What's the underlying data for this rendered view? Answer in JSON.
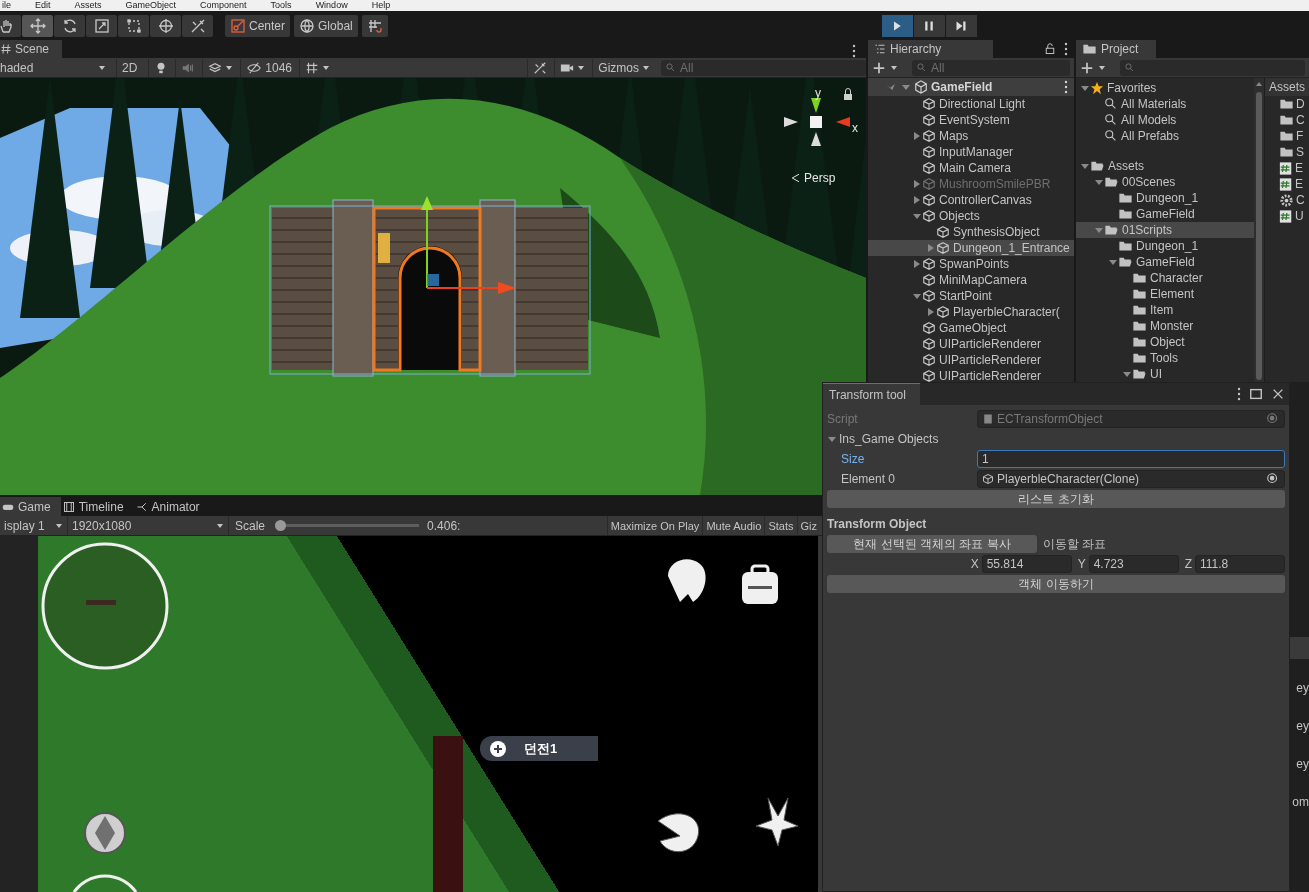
{
  "menu": [
    "ile",
    "Edit",
    "Assets",
    "GameObject",
    "Component",
    "Tools",
    "Window",
    "Help"
  ],
  "tools": [
    {
      "kind": "hand",
      "selected": false
    },
    {
      "kind": "move",
      "selected": true
    },
    {
      "kind": "rotate",
      "selected": false
    },
    {
      "kind": "scale",
      "selected": false
    },
    {
      "kind": "rect",
      "selected": false
    },
    {
      "kind": "transform",
      "selected": false
    },
    {
      "kind": "custom",
      "selected": false
    }
  ],
  "pivot_buttons": [
    {
      "kind": "pivot",
      "label": "Center"
    },
    {
      "kind": "space",
      "label": "Global"
    },
    {
      "kind": "snap"
    }
  ],
  "playback": [
    {
      "kind": "play",
      "on": true
    },
    {
      "kind": "pause",
      "on": false
    },
    {
      "kind": "step",
      "on": false
    }
  ],
  "scene": {
    "tab": "Scene",
    "shading": "haded",
    "mode_2d": "2D",
    "hidden_count": "1046",
    "gizmos": "Gizmos",
    "search_placeholder": "All",
    "axis_y": "y",
    "axis_x": "x",
    "projection": "Persp"
  },
  "hierarchy": {
    "tab": "Hierarchy",
    "search_placeholder": "All",
    "root": "GameField",
    "items": [
      {
        "label": "Directional Light",
        "disabled": false,
        "selected": false
      },
      {
        "label": "EventSystem",
        "disabled": false,
        "selected": false
      },
      {
        "label": "Maps",
        "expanded": false,
        "disabled": false,
        "selected": false
      },
      {
        "label": "InputManager",
        "disabled": false,
        "selected": false
      },
      {
        "label": "Main Camera",
        "disabled": false,
        "selected": false
      },
      {
        "label": "MushroomSmilePBR",
        "expanded": false,
        "disabled": true,
        "selected": false
      },
      {
        "label": "ControllerCanvas",
        "expanded": false,
        "disabled": false,
        "selected": false
      },
      {
        "label": "Objects",
        "expanded": true,
        "disabled": false,
        "selected": false,
        "children": [
          {
            "label": "SynthesisObject",
            "disabled": false,
            "selected": false
          },
          {
            "label": "Dungeon_1_Entrance",
            "expanded": false,
            "disabled": false,
            "selected": true
          }
        ]
      },
      {
        "label": "SpwanPoints",
        "expanded": false,
        "disabled": false,
        "selected": false
      },
      {
        "label": "MiniMapCamera",
        "disabled": false,
        "selected": false
      },
      {
        "label": "StartPoint",
        "expanded": true,
        "disabled": false,
        "selected": false,
        "children": [
          {
            "label": "PlayerbleCharacter(",
            "expanded": false,
            "disabled": false,
            "selected": false
          }
        ]
      },
      {
        "label": "GameObject",
        "disabled": false,
        "selected": false
      },
      {
        "label": "UIParticleRenderer",
        "disabled": false,
        "selected": false
      },
      {
        "label": "UIParticleRenderer",
        "disabled": false,
        "selected": false
      },
      {
        "label": "UIParticleRenderer",
        "disabled": false,
        "selected": false
      }
    ]
  },
  "project": {
    "tab": "Project",
    "tree": [
      {
        "label": "Favorites",
        "kind": "star",
        "expanded": true,
        "selected": false,
        "children": [
          {
            "label": "All Materials",
            "kind": "search",
            "selected": false
          },
          {
            "label": "All Models",
            "kind": "search",
            "selected": false
          },
          {
            "label": "All Prefabs",
            "kind": "search",
            "selected": false
          }
        ]
      },
      {
        "label": "Assets",
        "kind": "folder",
        "expanded": true,
        "selected": false,
        "children": [
          {
            "label": "00Scenes",
            "kind": "folder",
            "expanded": true,
            "selected": false,
            "children": [
              {
                "label": "Dungeon_1",
                "kind": "folder",
                "selected": false
              },
              {
                "label": "GameField",
                "kind": "folder",
                "selected": false
              }
            ]
          },
          {
            "label": "01Scripts",
            "kind": "folder",
            "expanded": true,
            "selected": true,
            "children": [
              {
                "label": "Dungeon_1",
                "kind": "folder",
                "selected": false
              },
              {
                "label": "GameField",
                "kind": "folder",
                "expanded": true,
                "selected": false,
                "children": [
                  {
                    "label": "Character",
                    "kind": "folder",
                    "selected": false
                  },
                  {
                    "label": "Element",
                    "kind": "folder",
                    "selected": false
                  },
                  {
                    "label": "Item",
                    "kind": "folder",
                    "selected": false
                  },
                  {
                    "label": "Monster",
                    "kind": "folder",
                    "selected": false
                  },
                  {
                    "label": "Object",
                    "kind": "folder",
                    "selected": false
                  },
                  {
                    "label": "Tools",
                    "kind": "folder",
                    "selected": false
                  },
                  {
                    "label": "UI",
                    "kind": "folder",
                    "expanded": true,
                    "selected": false
                  }
                ]
              }
            ]
          }
        ]
      }
    ],
    "breadcrumb": "Assets",
    "files": [
      {
        "kind": "folder",
        "label": "D"
      },
      {
        "kind": "folder",
        "label": "C"
      },
      {
        "kind": "folder",
        "label": "F"
      },
      {
        "kind": "folder",
        "label": "S"
      },
      {
        "kind": "script",
        "label": "E"
      },
      {
        "kind": "script",
        "label": "E"
      },
      {
        "kind": "settings",
        "label": "C"
      },
      {
        "kind": "script",
        "label": "U"
      }
    ]
  },
  "game": {
    "tabs": [
      {
        "kind": "game",
        "label": "Game",
        "selected": true
      },
      {
        "kind": "timeline",
        "label": "Timeline",
        "selected": false
      },
      {
        "kind": "animator",
        "label": "Animator",
        "selected": false
      }
    ],
    "display": "isplay 1",
    "resolution": "1920x1080",
    "scale_label": "Scale",
    "scale": {
      "level": 0,
      "reading": "0.406:"
    },
    "buttons": [
      "Maximize On Play",
      "Mute Audio",
      "Stats",
      "Giz"
    ],
    "portal_label": "던전1"
  },
  "transform_tool": {
    "title": "Transform tool",
    "script_label": "Script",
    "script_value": "ECTransformObject",
    "list_label": "Ins_Game Objects",
    "list_expanded": true,
    "size": {
      "label": "Size",
      "value": "1",
      "focused": true
    },
    "element": {
      "label": "Element 0",
      "value": "PlayerbleCharacter(Clone)"
    },
    "reset_button": "리스트 초기화",
    "section": "Transform Object",
    "copy_button": "현재 선택된 객체의 좌표 복사",
    "target_label": "이동할 좌표",
    "coords": [
      {
        "axis": "X",
        "value": "55.814"
      },
      {
        "axis": "Y",
        "value": "4.723"
      },
      {
        "axis": "Z",
        "value": "111.8"
      }
    ],
    "move_button": "객체 이동하기"
  },
  "console_fragments": [
    "ey",
    "ey",
    "ey",
    "om"
  ]
}
